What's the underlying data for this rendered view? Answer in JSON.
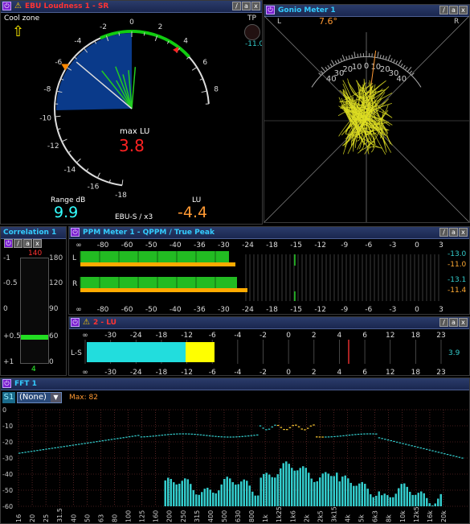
{
  "loudness": {
    "title": "EBU Loudness 1 - SR",
    "cool_zone": "Cool zone",
    "tp_label": "TP",
    "tp_value": "-11.0",
    "scale": [
      "-18",
      "-16",
      "-14",
      "-12",
      "-10",
      "-8",
      "-6",
      "-4",
      "-2",
      "0",
      "2",
      "4",
      "6",
      "8"
    ],
    "max_lu_label": "max LU",
    "max_lu_value": "3.8",
    "range_label": "Range dB",
    "range_value": "9.9",
    "lu_label": "LU",
    "lu_value": "-4.4",
    "mode": "EBU-S / x3",
    "colors": {
      "red": "#ff2222",
      "cyan": "#33ffff",
      "orange": "#ff9933",
      "arc_green": "#11cc11",
      "fill_blue": "#0a3a8a"
    }
  },
  "gonio": {
    "title": "Gonio Meter 1",
    "left": "L",
    "right": "R",
    "angle": "7.6°",
    "scale_left": [
      "40",
      "30",
      "20",
      "10"
    ],
    "scale_center": "0",
    "scale_right": [
      "10",
      "20",
      "30",
      "40"
    ]
  },
  "correlation": {
    "title": "Correlation 1",
    "top_value": "140",
    "bottom_value": "4",
    "left_scale": [
      "-1",
      "-0.5",
      "0",
      "+0.5",
      "+1"
    ],
    "right_scale": [
      "180",
      "120",
      "90",
      "60",
      "0"
    ]
  },
  "ppm": {
    "title": "PPM Meter 1 - QPPM / True Peak",
    "scale": [
      "∞",
      "-80",
      "-60",
      "-50",
      "-40",
      "-36",
      "-30",
      "-24",
      "-18",
      "-15",
      "-12",
      "-9",
      "-6",
      "-3",
      "0",
      "3"
    ],
    "channels": [
      {
        "label": "L",
        "rms": "-13.0",
        "peak": "-11.0"
      },
      {
        "label": "R",
        "rms": "-13.1",
        "peak": "-11.4"
      }
    ]
  },
  "lu_meter": {
    "title": "2 - LU",
    "scale": [
      "∞",
      "-30",
      "-24",
      "-18",
      "-12",
      "-6",
      "-4",
      "-2",
      "0",
      "2",
      "4",
      "6",
      "12",
      "18",
      "23"
    ],
    "channel_label": "L-S",
    "value": "3.9"
  },
  "fft": {
    "title": "FFT 1",
    "channel_badge": "S1",
    "dropdown": "(None)",
    "max_label": "Max: 82",
    "y_scale": [
      "0",
      "-10",
      "-20",
      "-30",
      "-40",
      "-50",
      "-60"
    ],
    "x_scale": [
      "16",
      "20",
      "25",
      "31.5",
      "40",
      "50",
      "63",
      "80",
      "100",
      "125",
      "160",
      "200",
      "250",
      "315",
      "400",
      "500",
      "630",
      "800",
      "1k",
      "1k25",
      "1k6",
      "2k",
      "2k5",
      "3k15",
      "4k",
      "5k",
      "6k3",
      "8k",
      "10k",
      "12k5",
      "16k",
      "20k"
    ]
  }
}
